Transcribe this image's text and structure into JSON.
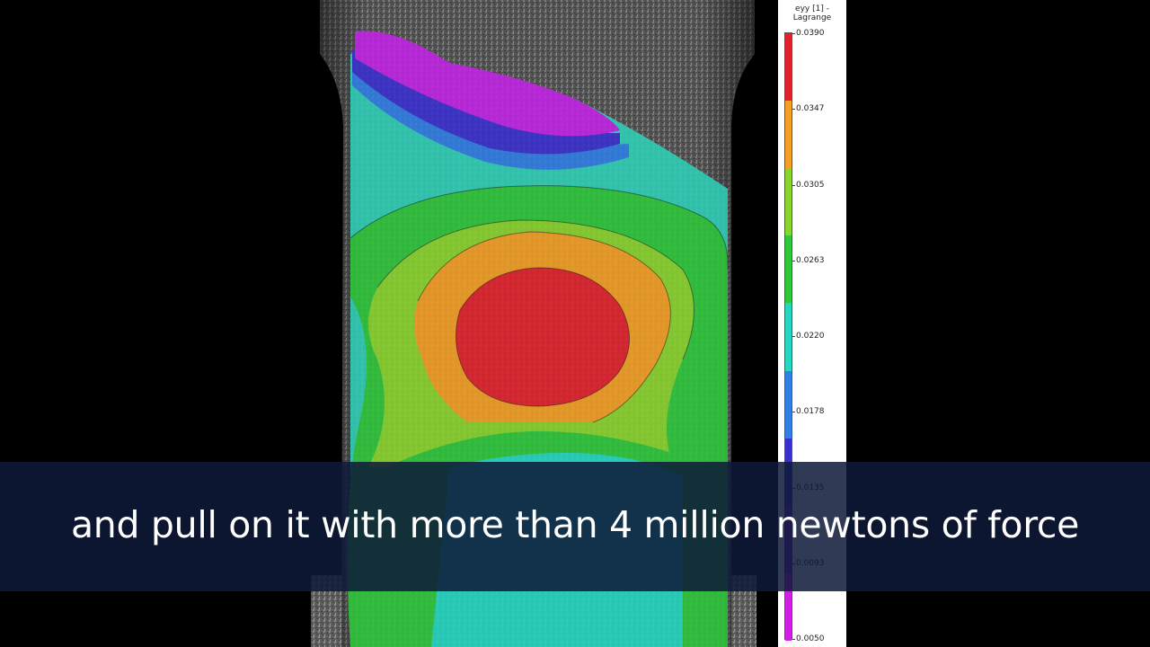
{
  "legend": {
    "title_line1": "eyy [1] -",
    "title_line2": "Lagrange",
    "ticks": [
      "0.0390",
      "0.0347",
      "0.0305",
      "0.0263",
      "0.0220",
      "0.0178",
      "0.0135",
      "0.0093",
      "0.0050"
    ],
    "colors": [
      "#e3212b",
      "#f59f24",
      "#8ad52d",
      "#2ec83b",
      "#23d8c2",
      "#2f7fe6",
      "#3a2fd0",
      "#8a22d6",
      "#d21ee6"
    ]
  },
  "caption": {
    "text": "and pull on it with more than 4 million newtons of force"
  },
  "icons": {
    "specimen": "concrete-specimen-strain-map"
  }
}
